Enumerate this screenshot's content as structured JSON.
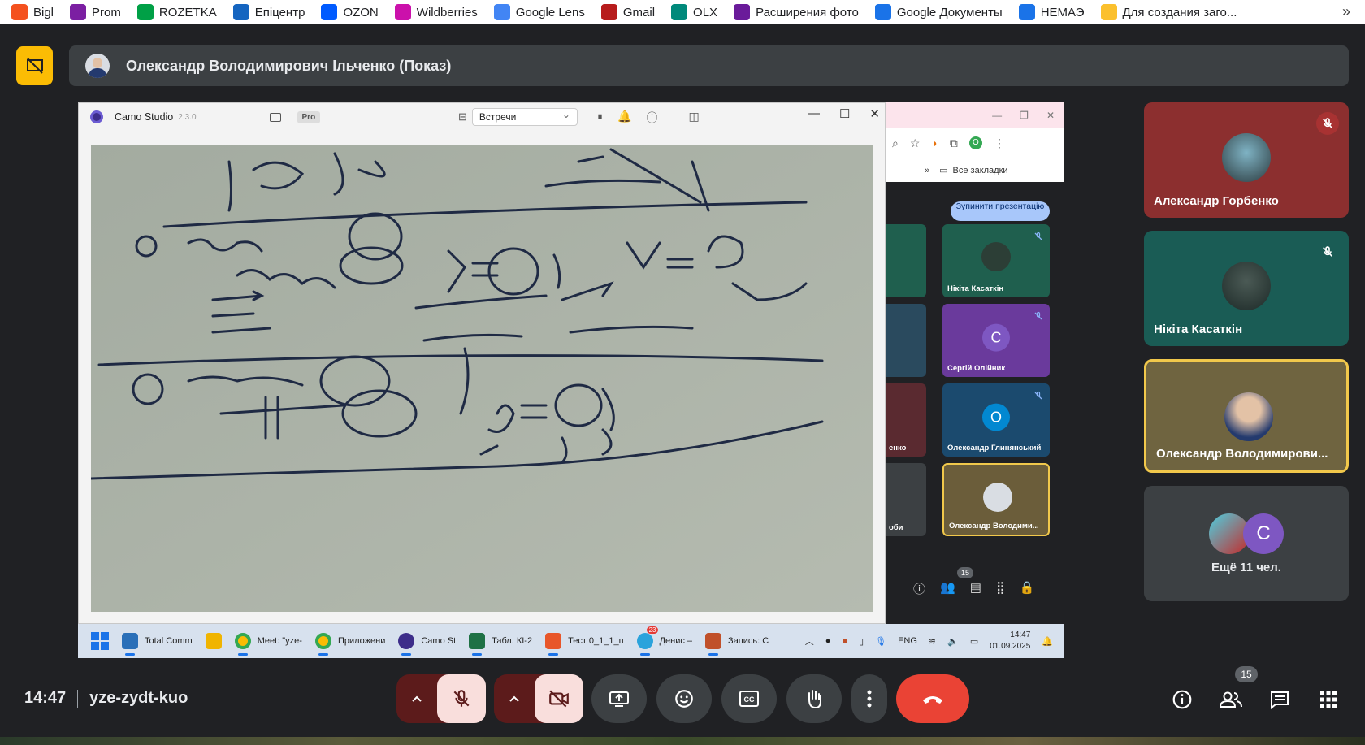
{
  "bookmarks": {
    "items": [
      {
        "label": "Bigl",
        "color": "#f4511e"
      },
      {
        "label": "Prom",
        "color": "#7b1fa2"
      },
      {
        "label": "ROZETKA",
        "color": "#00a046"
      },
      {
        "label": "Епіцентр",
        "color": "#1565c0"
      },
      {
        "label": "OZON",
        "color": "#005bff"
      },
      {
        "label": "Wildberries",
        "color": "#cb11ab"
      },
      {
        "label": "Google Lens",
        "color": "#4285f4"
      },
      {
        "label": "Gmail",
        "color": "#b71c1c"
      },
      {
        "label": "OLX",
        "color": "#00897b"
      },
      {
        "label": "Расширения фото",
        "color": "#6a1b9a"
      },
      {
        "label": "Google Документы",
        "color": "#1a73e8"
      },
      {
        "label": "НЕМАЭ",
        "color": "#1a73e8"
      },
      {
        "label": "Для создания заго...",
        "color": "#fbc02d"
      }
    ],
    "more": "»"
  },
  "presentation": {
    "title": "Олександр Володимирович Ільченко (Показ)",
    "accent": "#fbbc04"
  },
  "camo": {
    "app_name": "Camo Studio",
    "version": "2.3.0",
    "pro_badge": "Pro",
    "source_select": "Встречи"
  },
  "shared_browser": {
    "bookmarks_label": "Все закладки",
    "stop_presentation": "Зупинити презентацію",
    "participants_count": "15",
    "tiles": [
      {
        "name": "Нікіта Касаткін",
        "color": "#1f5f4e",
        "muted": true,
        "letter": ""
      },
      {
        "name": "Сергій Олійник",
        "color": "#6a3a9c",
        "muted": true,
        "letter": "С"
      },
      {
        "name": "Олександр Глинянський",
        "color": "#1b4a6e",
        "muted": true,
        "letter": "О"
      },
      {
        "name": "Олександр Володими...",
        "color": "#6b5d3a",
        "muted": false,
        "letter": ""
      }
    ],
    "left_tiles": [
      {
        "name": "",
        "color": "#1f5f4e"
      },
      {
        "name": "",
        "color": "#2a4a5e"
      },
      {
        "name": "енко",
        "color": "#5a2a30"
      },
      {
        "name": "оби",
        "color": "#3c4043"
      }
    ]
  },
  "taskbar": {
    "apps": [
      {
        "label": "Total Comm",
        "color": "#2a6fb8",
        "icon": "globe-icon"
      },
      {
        "label": "",
        "color": "#f0b400",
        "icon": "folder-icon"
      },
      {
        "label": "Meet: \"yze-",
        "color": "#34a853",
        "icon": "chrome-icon"
      },
      {
        "label": "Приложени",
        "color": "#34a853",
        "icon": "chrome-icon"
      },
      {
        "label": "Camo St",
        "color": "#3d2d8a",
        "icon": "camo-icon"
      },
      {
        "label": "Табл. КІ-2",
        "color": "#1e7145",
        "icon": "excel-icon"
      },
      {
        "label": "Тест 0_1_1_п",
        "color": "#e8562a",
        "icon": "test-icon"
      },
      {
        "label": "Денис –",
        "color": "#2aa3dc",
        "icon": "telegram-icon",
        "badge": "23"
      },
      {
        "label": "Запись: С",
        "color": "#c0502a",
        "icon": "record-icon"
      }
    ],
    "lang": "ENG",
    "time": "14:47",
    "date": "01.09.2025"
  },
  "participants": [
    {
      "name": "Александр Горбенко",
      "color": "#8c2f2f",
      "muted": true
    },
    {
      "name": "Нікіта Касаткін",
      "color": "#1a5c55",
      "muted": true
    },
    {
      "name": "Олександр Володимирови...",
      "color": "#6f6440",
      "muted": false,
      "speaking": true
    },
    {
      "name": "",
      "color": "#3c4043",
      "more": "Ещё 11 чел.",
      "letter": "С"
    }
  ],
  "bottom": {
    "time": "14:47",
    "meeting_code": "yze-zydt-kuo",
    "participants_badge": "15",
    "end_call_color": "#ea4335"
  }
}
